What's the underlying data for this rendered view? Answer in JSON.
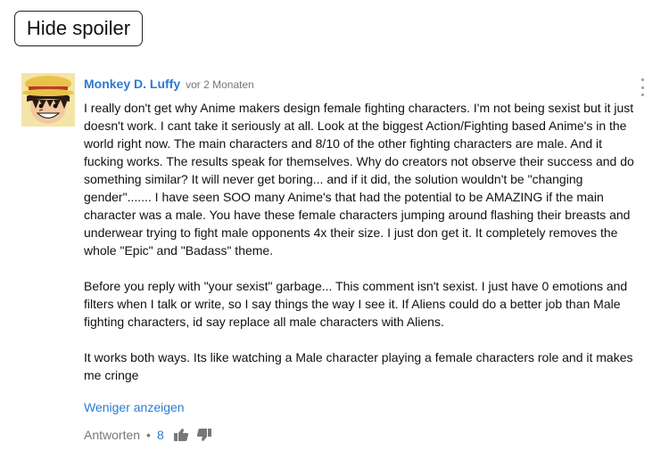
{
  "spoiler": {
    "label": "Hide spoiler"
  },
  "comment": {
    "author": "Monkey D. Luffy",
    "timestamp": "vor 2 Monaten",
    "paragraphs": [
      "I really don't get why Anime makers design female fighting characters. I'm not being sexist but it just doesn't work. I cant take it seriously at all. Look at the biggest Action/Fighting based Anime's in the world right now. The main characters and 8/10 of the other fighting characters are male. And it fucking works. The results speak for themselves. Why do creators not observe their success and do something similar? It will never get boring... and if it did, the solution wouldn't be \"changing gender\"....... I have seen SOO many Anime's that had the potential to be AMAZING if the main character was a male. You have these female characters jumping around flashing their breasts and underwear trying to fight male opponents 4x their size. I just don get it. It completely removes the whole \"Epic\" and \"Badass\" theme.",
      "Before you reply with \"your sexist\" garbage... This comment isn't sexist. I just have 0 emotions and filters when I talk or write, so I say things the way I see it. If Aliens could do a better job than Male fighting characters, id say replace all male characters with Aliens.",
      "It works both ways. Its like watching a Male character playing a female characters role and it makes me cringe"
    ],
    "show_less": "Weniger anzeigen",
    "reply_label": "Antworten",
    "separator": "•",
    "like_count": "8"
  },
  "icons": {
    "avatar": "luffy-avatar",
    "menu": "kebab-menu-icon",
    "like": "thumbs-up-icon",
    "dislike": "thumbs-down-icon"
  },
  "colors": {
    "link": "#2b7bd1",
    "meta": "#777777",
    "text": "#111111"
  }
}
